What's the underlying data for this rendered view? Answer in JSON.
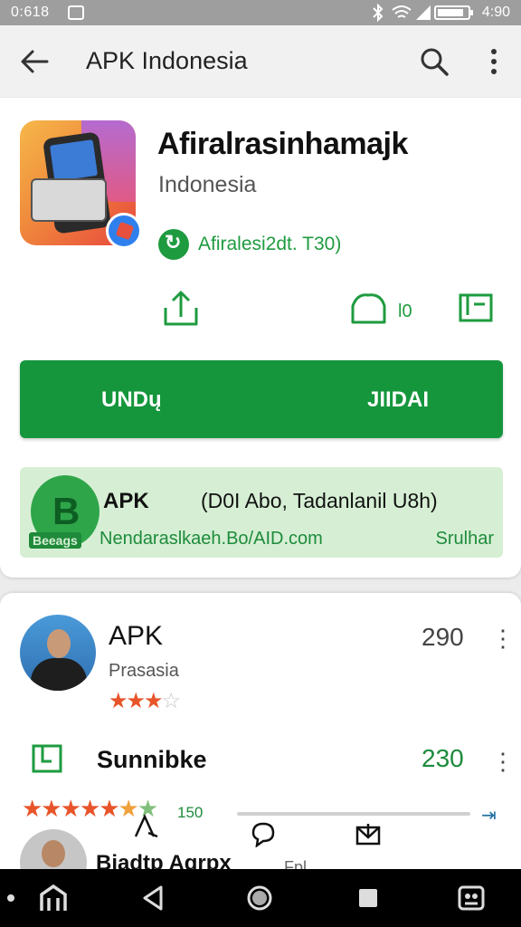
{
  "status_bar": {
    "time": "0:618",
    "right_time": "4:90"
  },
  "app_bar": {
    "title": "APK Indonesia"
  },
  "app": {
    "name": "Afiralrasinhamajk",
    "developer": "Indonesia",
    "verified_text": "Afiralesi2dt. T30)",
    "actions": {
      "count": "l0"
    }
  },
  "download_button": {
    "left_label": "UNDų",
    "right_label": "JIIDAI"
  },
  "promo": {
    "logo_tag": "Beeags",
    "title": "APK",
    "description": "(D0I Abo, Tadanlanil U8h)",
    "url": "Nendaraslkaeh.Bo/AID.com",
    "link": "Srulhar"
  },
  "list": [
    {
      "title": "APK",
      "subtitle": "Prasasia",
      "rating_stars": 3,
      "count": "290"
    },
    {
      "title": "Sunnibke",
      "count": "230"
    },
    {
      "rating_value": "150",
      "rating_stars": 6.5
    },
    {
      "title": "Biadtp Agrpx",
      "extra": "Fpl"
    }
  ],
  "colors": {
    "brand_green": "#15963c",
    "promo_bg": "#d6efd4",
    "star": "#e8542a"
  }
}
